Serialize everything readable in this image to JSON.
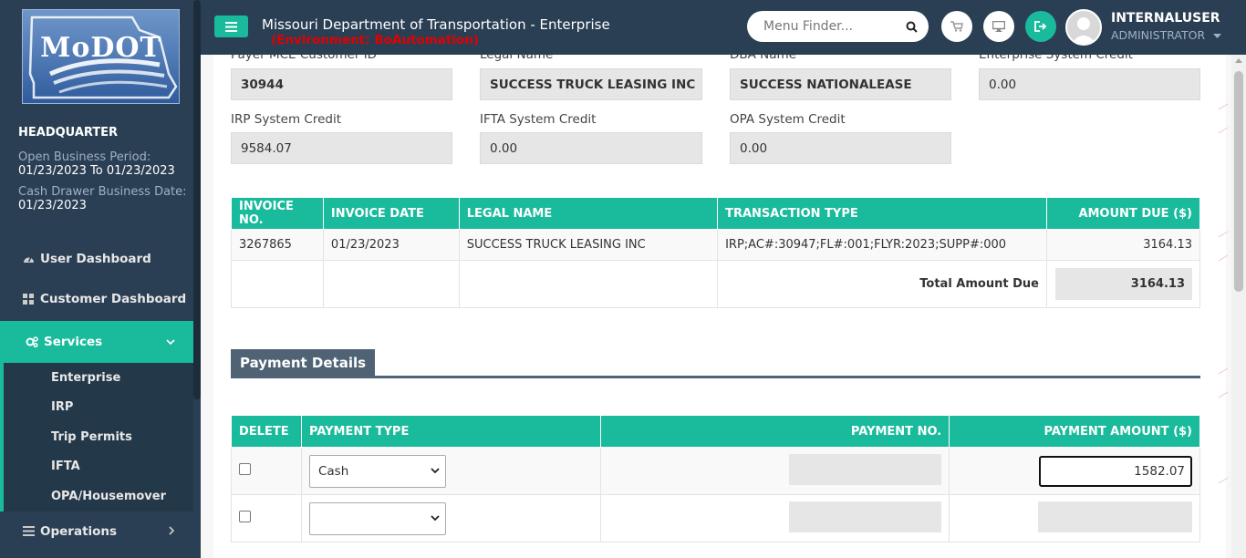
{
  "sidebar": {
    "logo_text": "MoDOT",
    "location": "HEADQUARTER",
    "open_period_label": "Open Business Period:",
    "open_period_value": "01/23/2023 To 01/23/2023",
    "cash_drawer_label": "Cash Drawer Business Date:",
    "cash_drawer_value": "01/23/2023",
    "nav": {
      "user_dashboard": "User Dashboard",
      "customer_dashboard": "Customer Dashboard",
      "services": "Services",
      "operations": "Operations"
    },
    "services_sub": [
      "Enterprise",
      "IRP",
      "Trip Permits",
      "IFTA",
      "OPA/Housemover"
    ]
  },
  "header": {
    "title": "Missouri Department of Transportation - Enterprise",
    "environment": "(Environment: BoAutomation)",
    "menu_finder_placeholder": "Menu Finder...",
    "user_name": "INTERNALUSER",
    "user_role": "ADMINISTRATOR"
  },
  "customer": {
    "payer_id_label": "Payer MCE Customer ID",
    "payer_id": "30944",
    "legal_name_label": "Legal Name",
    "legal_name": "SUCCESS TRUCK LEASING INC",
    "dba_label": "DBA Name",
    "dba": "SUCCESS NATIONALEASE",
    "enterprise_credit_label": "Enterprise System Credit",
    "enterprise_credit": "0.00",
    "irp_credit_label": "IRP System Credit",
    "irp_credit": "9584.07",
    "ifta_credit_label": "IFTA System Credit",
    "ifta_credit": "0.00",
    "opa_credit_label": "OPA System Credit",
    "opa_credit": "0.00"
  },
  "invoice_table": {
    "headers": [
      "INVOICE NO.",
      "INVOICE DATE",
      "LEGAL NAME",
      "TRANSACTION TYPE",
      "AMOUNT DUE ($)"
    ],
    "rows": [
      [
        "3267865",
        "01/23/2023",
        "SUCCESS TRUCK LEASING INC",
        "IRP;AC#:30947;FL#:001;FLYR:2023;SUPP#:000",
        "3164.13"
      ]
    ],
    "total_label": "Total Amount Due",
    "total_value": "3164.13"
  },
  "payment": {
    "section_title": "Payment Details",
    "headers": [
      "DELETE",
      "PAYMENT TYPE",
      "PAYMENT NO.",
      "PAYMENT AMOUNT ($)"
    ],
    "rows": [
      {
        "type": "Cash",
        "amount": "1582.07"
      },
      {
        "type": "",
        "amount": ""
      }
    ]
  },
  "colors": {
    "sidebar": "#2a3f54",
    "accent": "#1abb9c",
    "env_text": "#e10000",
    "section_tab": "#4f6375"
  }
}
